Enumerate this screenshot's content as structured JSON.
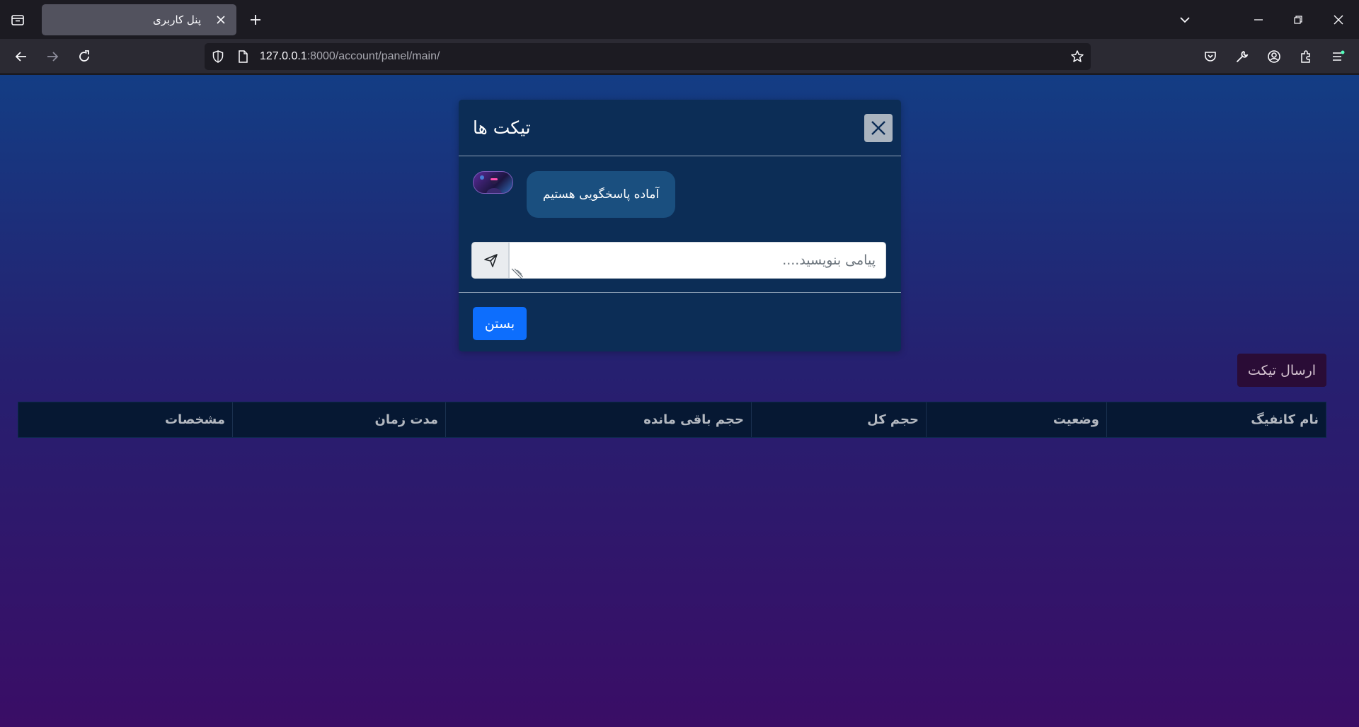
{
  "browser": {
    "tab_title": "پنل کاربری",
    "url_host": "127.0.0.1",
    "url_rest": ":8000/account/panel/main/"
  },
  "modal": {
    "title": "تیکت ها",
    "message": "آماده پاسخگویی هستیم",
    "input_placeholder": "پیامی بنویسید....",
    "input_value": "",
    "close_label": "بستن"
  },
  "page": {
    "send_ticket_label": "ارسال تیکت",
    "table": {
      "headers": [
        "نام کانفیگ",
        "وضعیت",
        "حجم کل",
        "حجم باقی مانده",
        "مدت زمان",
        "مشخصات"
      ]
    }
  }
}
